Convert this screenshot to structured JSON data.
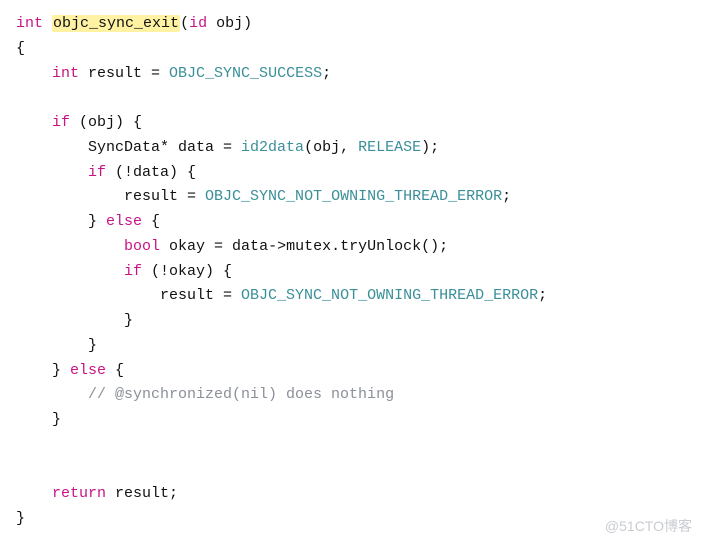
{
  "code": {
    "l1": {
      "kw": "int",
      "fn": "objc_sync_exit",
      "sig_open": "(",
      "sig_type": "id",
      "sig_rest": " obj)"
    },
    "l2": "{",
    "l3": {
      "indent": "    ",
      "kw": "int",
      "rest": " result = ",
      "ident": "OBJC_SYNC_SUCCESS",
      "tail": ";"
    },
    "l4": "    ",
    "l5": {
      "indent": "    ",
      "kw": "if",
      "rest": " (obj) {"
    },
    "l6": {
      "indent": "        ",
      "text": "SyncData* data = ",
      "fn": "id2data",
      "args_open": "(obj, ",
      "ident": "RELEASE",
      "tail": ");"
    },
    "l7": {
      "indent": "        ",
      "kw": "if",
      "rest": " (!data) {"
    },
    "l8": {
      "indent": "            ",
      "text": "result = ",
      "ident": "OBJC_SYNC_NOT_OWNING_THREAD_ERROR",
      "tail": ";"
    },
    "l9": {
      "indent": "        ",
      "close": "} ",
      "kw": "else",
      "rest": " {"
    },
    "l10": {
      "indent": "            ",
      "kw": "bool",
      "rest": " okay = data->mutex.tryUnlock();"
    },
    "l11": {
      "indent": "            ",
      "kw": "if",
      "rest": " (!okay) {"
    },
    "l12": {
      "indent": "                ",
      "text": "result = ",
      "ident": "OBJC_SYNC_NOT_OWNING_THREAD_ERROR",
      "tail": ";"
    },
    "l13": "            }",
    "l14": "        }",
    "l15": {
      "indent": "    ",
      "close": "} ",
      "kw": "else",
      "rest": " {"
    },
    "l16": {
      "indent": "        ",
      "comment": "// @synchronized(nil) does nothing"
    },
    "l17": "    }",
    "l18": "",
    "l19": "",
    "l20": {
      "indent": "    ",
      "kw": "return",
      "rest": " result;"
    },
    "l21": "}"
  },
  "watermark": "@51CTO博客"
}
